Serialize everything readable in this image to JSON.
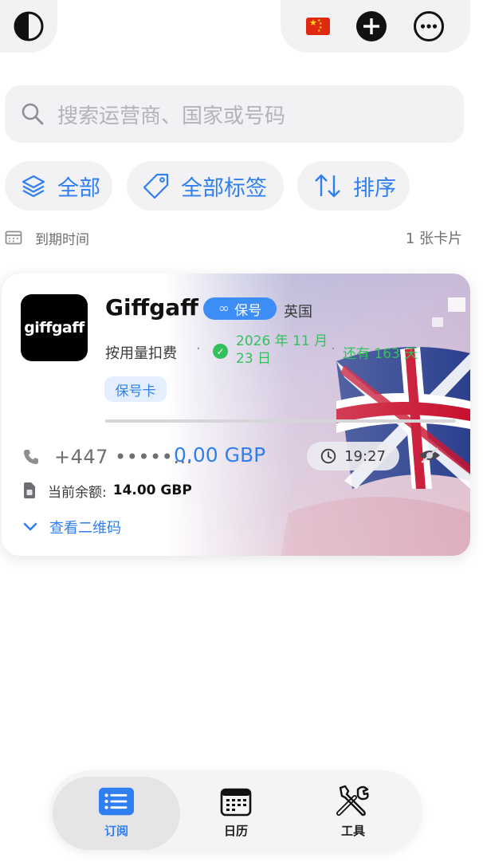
{
  "topbar": {
    "theme_icon": "contrast-icon",
    "flag_icon": "china-flag-icon",
    "add_icon": "plus-circle-icon",
    "more_icon": "ellipsis-circle-icon"
  },
  "search": {
    "placeholder": "搜索运营商、国家或号码",
    "icon": "search-icon"
  },
  "filters": [
    {
      "label": "全部",
      "icon": "layers-icon"
    },
    {
      "label": "全部标签",
      "icon": "tag-icon"
    },
    {
      "label": "排序",
      "icon": "sort-arrows-icon"
    }
  ],
  "list_info": {
    "sort_label": "到期时间",
    "count": "1 张卡片"
  },
  "card": {
    "logo_text": "giffgaff",
    "name": "Giffgaff",
    "keep_badge": "保号",
    "country": "英国",
    "plan": "按用量扣费",
    "separator": "·",
    "expiry_line1": "2026 年 11 月",
    "expiry_line2": "23 日",
    "remaining": "还有 163 天",
    "tag": "保号卡",
    "phone": "+447 •••••...",
    "balance_display": "0.00 GBP",
    "time": "19:27",
    "balance_label": "当前余额:",
    "balance_value": "14.00 GBP",
    "qr_label": "查看二维码",
    "colors": {
      "accent": "#2f7ff0",
      "green": "#33c15b",
      "badge": "#3c8df5"
    }
  },
  "tabs": [
    {
      "label": "订阅",
      "icon": "list-icon",
      "active": true
    },
    {
      "label": "日历",
      "icon": "calendar-icon",
      "active": false
    },
    {
      "label": "工具",
      "icon": "tools-icon",
      "active": false
    }
  ]
}
